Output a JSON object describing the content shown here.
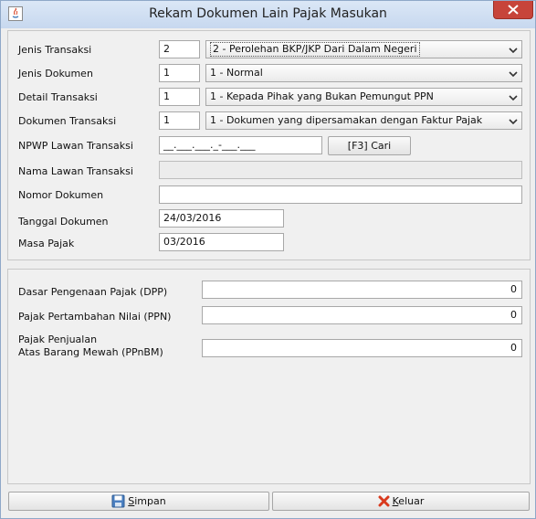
{
  "window": {
    "title": "Rekam Dokumen Lain Pajak Masukan",
    "icon": "java-icon"
  },
  "form": {
    "jenis_transaksi": {
      "label": "Jenis Transaksi",
      "code": "2",
      "selected": "2 - Perolehan BKP/JKP Dari Dalam Negeri"
    },
    "jenis_dokumen": {
      "label": "Jenis Dokumen",
      "code": "1",
      "selected": "1 - Normal"
    },
    "detail_transaksi": {
      "label": "Detail Transaksi",
      "code": "1",
      "selected": "1 - Kepada Pihak yang Bukan Pemungut PPN"
    },
    "dokumen_transaksi": {
      "label": "Dokumen Transaksi",
      "code": "1",
      "selected": "1 - Dokumen yang dipersamakan dengan Faktur Pajak"
    },
    "npwp": {
      "label": "NPWP Lawan Transaksi",
      "value": "__.___.___._-___.___",
      "button": "[F3] Cari"
    },
    "nama_lawan": {
      "label": "Nama Lawan Transaksi",
      "value": ""
    },
    "nomor_dokumen": {
      "label": "Nomor Dokumen",
      "value": ""
    },
    "tanggal_dokumen": {
      "label": "Tanggal Dokumen",
      "value": "24/03/2016"
    },
    "masa_pajak": {
      "label": "Masa Pajak",
      "value": "03/2016"
    }
  },
  "amounts": {
    "dpp": {
      "label": "Dasar Pengenaan Pajak (DPP)",
      "value": "0"
    },
    "ppn": {
      "label": "Pajak Pertambahan Nilai (PPN)",
      "value": "0"
    },
    "ppnbm": {
      "label_line1": "Pajak Penjualan",
      "label_line2": "Atas Barang Mewah (PPnBM)",
      "value": "0"
    }
  },
  "buttons": {
    "simpan_first": "S",
    "simpan_rest": "impan",
    "keluar_first": "K",
    "keluar_rest": "eluar"
  },
  "colors": {
    "close_button": "#c7443a",
    "title_bar": "#c7d8ef"
  }
}
